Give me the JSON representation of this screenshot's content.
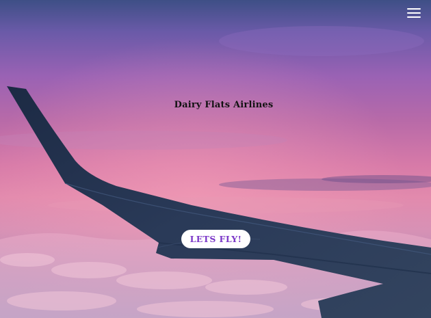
{
  "site": {
    "title": "Dairy Flats Airlines"
  },
  "nav": {
    "menu_icon": "hamburger-menu-icon"
  },
  "hero": {
    "cta_label": "LETS FLY!",
    "background": "airplane-wing-over-pink-clouds-sunset"
  },
  "colors": {
    "cta_text": "#7b38c8",
    "cta_background": "#ffffff",
    "title_text": "#121212",
    "menu_icon": "#ffffff"
  }
}
